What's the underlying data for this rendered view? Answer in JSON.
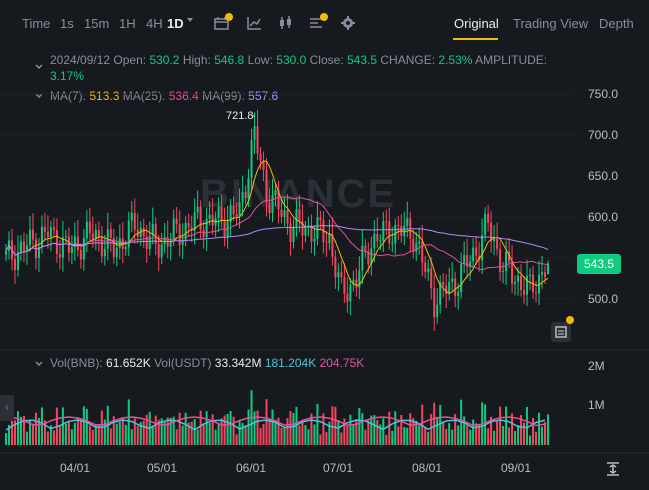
{
  "toolbar": {
    "time_label": "Time",
    "intervals": [
      "1s",
      "15m",
      "1H",
      "4H",
      "1D"
    ],
    "active_interval": "1D",
    "views": [
      "Original",
      "Trading View",
      "Depth"
    ],
    "active_view": "Original"
  },
  "ohlc": {
    "date": "2024/09/12",
    "open_label": "Open:",
    "open": "530.2",
    "high_label": "High:",
    "high": "546.8",
    "low_label": "Low:",
    "low": "530.0",
    "close_label": "Close:",
    "close": "543.5",
    "change_label": "CHANGE:",
    "change": "2.53%",
    "amplitude_label": "AMPLITUDE:",
    "amplitude": "3.17%"
  },
  "ma": {
    "ma7_label": "MA(7):",
    "ma7": "513.3",
    "ma25_label": "MA(25):",
    "ma25": "536.4",
    "ma99_label": "MA(99):",
    "ma99": "557.6"
  },
  "volume": {
    "vol_label": "Vol(BNB):",
    "vol_value": "61.652K",
    "volusdt_label": "Vol(USDT)",
    "volusdt_value": "33.342M",
    "ma1": "181.204K",
    "ma2": "204.75K"
  },
  "watermark": "BINANCE",
  "price_axis": [
    "750.0",
    "700.0",
    "650.0",
    "600.0",
    "550.0",
    "500.0"
  ],
  "volume_axis": [
    "2M",
    "1M"
  ],
  "time_axis": [
    "04/01",
    "05/01",
    "06/01",
    "07/01",
    "08/01",
    "09/01"
  ],
  "high_marker": "721.8",
  "last_price": "543.5",
  "colors": {
    "up": "#0ecb81",
    "down": "#f6465d",
    "ma7": "#f0b90b",
    "ma25": "#e84f9c",
    "ma99": "#b18cf6",
    "accent": "#f0b90b"
  },
  "chart_data": {
    "type": "candlestick",
    "x_start": "2024/03/15",
    "x_end": "2024/09/12",
    "price_axis_ticks": [
      750,
      700,
      650,
      600,
      550,
      500
    ],
    "anchor_closes": [
      [
        "2024/03/15",
        550
      ],
      [
        "2024/03/22",
        565
      ],
      [
        "2024/03/29",
        580
      ],
      [
        "2024/04/05",
        560
      ],
      [
        "2024/04/13",
        580
      ],
      [
        "2024/04/20",
        560
      ],
      [
        "2024/04/27",
        590
      ],
      [
        "2024/05/04",
        565
      ],
      [
        "2024/05/11",
        580
      ],
      [
        "2024/05/18",
        595
      ],
      [
        "2024/05/25",
        595
      ],
      [
        "2024/06/01",
        605
      ],
      [
        "2024/06/06",
        700
      ],
      [
        "2024/06/10",
        630
      ],
      [
        "2024/06/18",
        590
      ],
      [
        "2024/06/25",
        585
      ],
      [
        "2024/07/01",
        575
      ],
      [
        "2024/07/05",
        505
      ],
      [
        "2024/07/10",
        525
      ],
      [
        "2024/07/15",
        570
      ],
      [
        "2024/07/22",
        585
      ],
      [
        "2024/07/29",
        580
      ],
      [
        "2024/08/05",
        500
      ],
      [
        "2024/08/12",
        520
      ],
      [
        "2024/08/19",
        560
      ],
      [
        "2024/08/23",
        590
      ],
      [
        "2024/08/28",
        540
      ],
      [
        "2024/09/06",
        510
      ],
      [
        "2024/09/12",
        543.5
      ]
    ],
    "volume_axis_ticks": [
      "2M",
      "1M"
    ]
  }
}
